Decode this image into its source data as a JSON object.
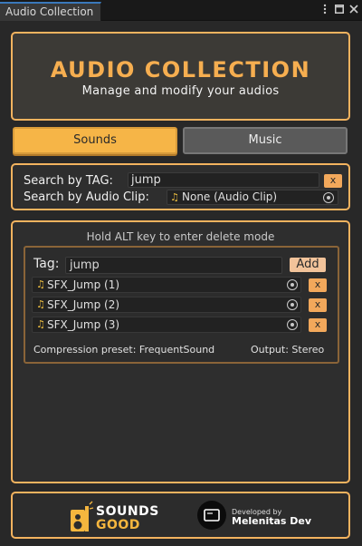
{
  "window": {
    "tab_title": "Audio Collection",
    "icons": [
      "more-options-icon",
      "maximize-icon",
      "close-icon"
    ]
  },
  "header": {
    "title": "AUDIO COLLECTION",
    "subtitle": "Manage and modify your audios"
  },
  "tabs": {
    "sounds": "Sounds",
    "music": "Music",
    "active": "Sounds"
  },
  "search": {
    "tag_label": "Search by TAG:",
    "tag_value": "jump",
    "clear_label": "x",
    "clip_label": "Search by Audio Clip:",
    "clip_value": "None (Audio Clip)"
  },
  "main": {
    "hint": "Hold ALT key to enter delete mode",
    "tag_label": "Tag:",
    "tag_value": "jump",
    "add_label": "Add",
    "clips": [
      {
        "name": "SFX_Jump (1)",
        "remove": "x"
      },
      {
        "name": "SFX_Jump (2)",
        "remove": "x"
      },
      {
        "name": "SFX_Jump (3)",
        "remove": "x"
      }
    ],
    "compression_label": "Compression preset:",
    "compression_value": "FrequentSound",
    "output_label": "Output:",
    "output_value": "Stereo"
  },
  "footer": {
    "logo1_line1": "SOUNDS",
    "logo1_line2": "GOOD",
    "logo2_line1": "Developed by",
    "logo2_line2": "Melenitas Dev"
  },
  "colors": {
    "accent": "#f3b35f",
    "tab_active": "#f6b547",
    "background": "#282828"
  }
}
